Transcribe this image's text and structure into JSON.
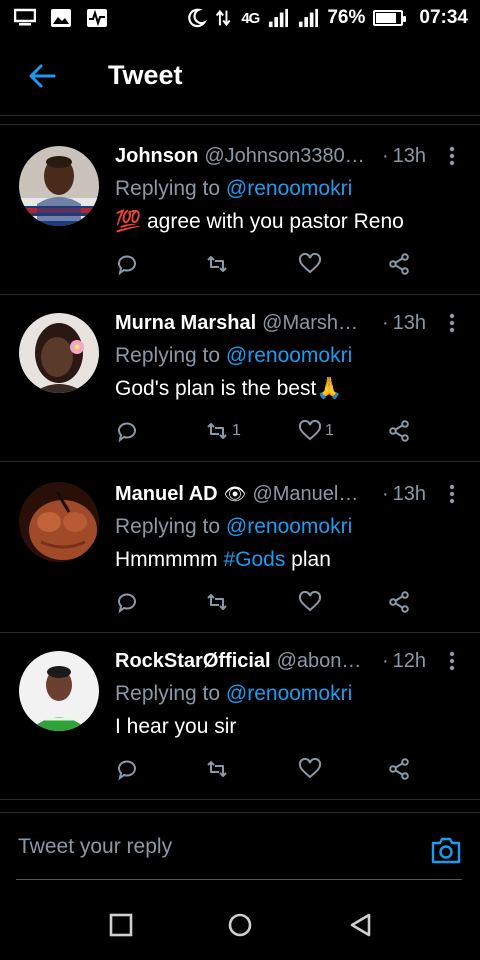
{
  "status_bar": {
    "network": "4G",
    "battery": "76%",
    "battery_level": 0.76,
    "time": "07:34",
    "icons": [
      "list-icon",
      "gallery-icon",
      "activity-icon",
      "moon-icon",
      "data-transfer-icon",
      "signal-icon",
      "signal-icon",
      "battery-icon"
    ]
  },
  "header": {
    "back_icon": "arrow-left-icon",
    "title": "Tweet"
  },
  "tweets": [
    {
      "name": "Johnson",
      "badge": "",
      "handle": "@Johnson3380…",
      "dot": "·",
      "time": "13h",
      "replying_prefix": "Replying to ",
      "replying_to": "@renoomokri",
      "emoji": "💯",
      "text": "agree with you pastor Reno",
      "text_tag": "",
      "text_after": "",
      "retweets": "",
      "likes": "",
      "avatar": "photo-johnson"
    },
    {
      "name": "Murna Marshal",
      "badge": "",
      "handle": "@Marsh…",
      "dot": "·",
      "time": "13h",
      "replying_prefix": "Replying to ",
      "replying_to": "@renoomokri",
      "emoji": "",
      "text": "God's plan is the best🙏",
      "text_tag": "",
      "text_after": "",
      "retweets": "1",
      "likes": "1",
      "avatar": "photo-murna"
    },
    {
      "name": "Manuel AD",
      "badge": "👁",
      "handle": "@Manuel…",
      "dot": "·",
      "time": "13h",
      "replying_prefix": "Replying to ",
      "replying_to": "@renoomokri",
      "emoji": "",
      "text": "Hmmmmm ",
      "text_tag": "#Gods",
      "text_after": " plan",
      "retweets": "",
      "likes": "",
      "avatar": "photo-manuel"
    },
    {
      "name": "RockStarØfficial",
      "badge": "",
      "handle": "@abon…",
      "dot": "·",
      "time": "12h",
      "replying_prefix": "Replying to ",
      "replying_to": "@renoomokri",
      "emoji": "",
      "text": "I hear you sir",
      "text_tag": "",
      "text_after": "",
      "retweets": "",
      "likes": "",
      "avatar": "photo-rockstar"
    }
  ],
  "reply": {
    "placeholder": "Tweet your reply",
    "camera_icon": "camera-icon"
  },
  "nav": {
    "icons": [
      "square-icon",
      "circle-icon",
      "triangle-back-icon"
    ]
  },
  "colors": {
    "background": "#000000",
    "accent": "#1d9bf0",
    "muted": "#8b98a5",
    "divider": "#2a2a2a"
  }
}
